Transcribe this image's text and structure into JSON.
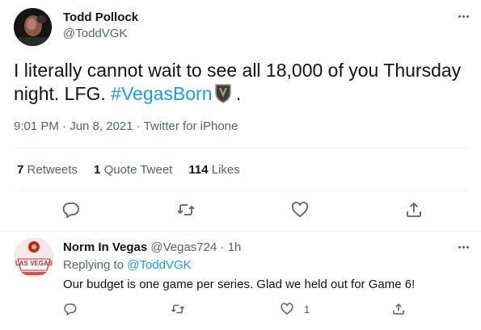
{
  "tweet": {
    "author_name": "Todd Pollock",
    "author_handle": "@ToddVGK",
    "text_before": "I literally cannot wait to see all 18,000 of you Thursday night. LFG. ",
    "hashtag": "#VegasBorn",
    "text_after": " .",
    "meta": "9:01 PM · Jun 8, 2021 · Twitter for iPhone",
    "retweets_count": "7",
    "retweets_label": "Retweets",
    "quotes_count": "1",
    "quotes_label": "Quote Tweet",
    "likes_count": "114",
    "likes_label": "Likes"
  },
  "reply": {
    "author_name": "Norm In Vegas",
    "author_handle": "@Vegas724",
    "separator": "·",
    "time": "1h",
    "replying_label": "Replying to",
    "replying_handle": "@ToddVGK",
    "text": "Our budget is one game per series. Glad we held out for Game 6!",
    "like_count": "1",
    "avatar_text": "LAS VEGAS"
  },
  "icons": {
    "reply": "reply-icon",
    "retweet": "retweet-icon",
    "like": "heart-icon",
    "share": "share-icon",
    "more": "more-icon",
    "shield": "vgk-shield-emoji"
  },
  "colors": {
    "link": "#1d9bf0",
    "secondary": "#536471",
    "text": "#0f1419"
  }
}
